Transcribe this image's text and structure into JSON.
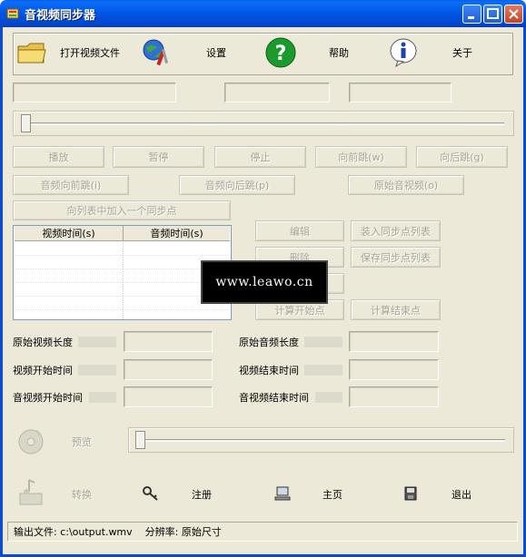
{
  "window": {
    "title": "音视频同步器"
  },
  "toolbar": {
    "open_label": "打开视频文件",
    "settings_label": "设置",
    "help_label": "帮助",
    "about_label": "关于"
  },
  "controls": {
    "play": "播放",
    "pause": "暂停",
    "stop": "停止",
    "jump_forward": "向前跳(w)",
    "jump_back": "向后跳(g)",
    "audio_forward": "音频向前跳(i)",
    "audio_back": "音频向后跳(p)",
    "original_av": "原始音视频(o)",
    "add_sync_point": "向列表中加入一个同步点",
    "edit": "编辑",
    "delete": "删除",
    "load_list": "装入同步点列表",
    "save_list": "保存同步点列表",
    "calc_start": "计算开始点",
    "calc_end": "计算结束点"
  },
  "list": {
    "col_video": "视频时间(s)",
    "col_audio": "音频时间(s)"
  },
  "info": {
    "video_length": "原始视频长度",
    "audio_length": "原始音频长度",
    "video_start": "视频开始时间",
    "video_end": "视频结束时间",
    "av_start": "音视频开始时间",
    "av_end": "音视频结束时间"
  },
  "bottom": {
    "preview": "预览",
    "convert": "转换",
    "register": "注册",
    "home": "主页",
    "exit": "退出"
  },
  "status": {
    "output_label": "输出文件: c:\\output.wmv",
    "ratio_label": "分辨率: 原始尺寸"
  },
  "watermark": "www.leawo.cn",
  "colors": {
    "titlebar": "#0055e5",
    "face": "#ece9d8",
    "disabled_text": "#a6a394"
  }
}
